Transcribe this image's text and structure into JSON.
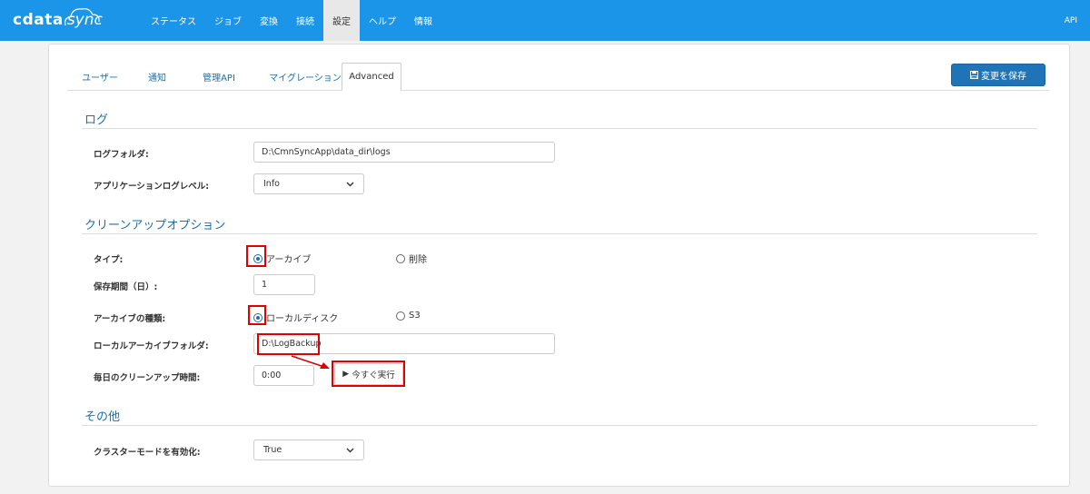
{
  "header": {
    "logo_data": "cdata",
    "logo_sync": "sync",
    "nav": [
      "ステータス",
      "ジョブ",
      "変換",
      "接続",
      "設定",
      "ヘルプ",
      "情報"
    ],
    "active_nav": "設定",
    "api_label": "API"
  },
  "tabs": [
    "ユーザー",
    "通知",
    "管理API",
    "マイグレーション",
    "Advanced"
  ],
  "active_tab": "Advanced",
  "save_button": "変更を保存",
  "sections": {
    "log": {
      "title": "ログ",
      "folder_label": "ログフォルダ:",
      "folder_value": "D:\\CmnSyncApp\\data_dir\\logs",
      "level_label": "アプリケーションログレベル:",
      "level_value": "Info"
    },
    "cleanup": {
      "title": "クリーンアップオプション",
      "type_label": "タイプ:",
      "type_options": [
        "アーカイブ",
        "削除"
      ],
      "type_selected": "アーカイブ",
      "retention_label": "保存期間（日）:",
      "retention_value": "1",
      "archive_kind_label": "アーカイブの種類:",
      "archive_kind_options": [
        "ローカルディスク",
        "S3"
      ],
      "archive_kind_selected": "ローカルディスク",
      "local_folder_label": "ローカルアーカイブフォルダ:",
      "local_folder_value": "D:\\LogBackup",
      "daily_time_label": "毎日のクリーンアップ時間:",
      "daily_time_value": "0:00",
      "run_now_button": "今すぐ実行"
    },
    "other": {
      "title": "その他",
      "cluster_label": "クラスターモードを有効化:",
      "cluster_value": "True"
    }
  },
  "colors": {
    "topbar": "#1a95e8",
    "accent": "#1a6fb0",
    "save_button": "#1f73b7",
    "highlight": "#e00000"
  }
}
